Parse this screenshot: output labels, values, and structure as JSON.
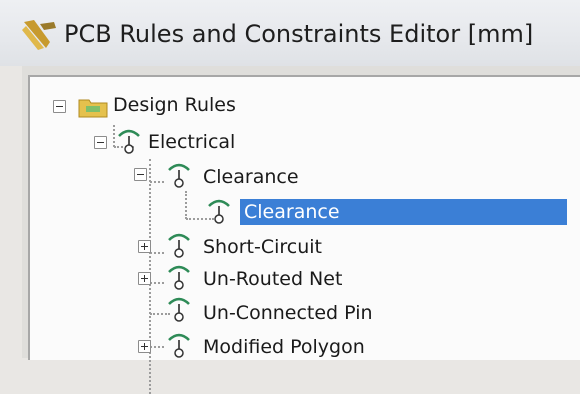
{
  "window": {
    "title": "PCB Rules and Constraints Editor [mm]",
    "app_icon": "pcb-editor-icon"
  },
  "tree": {
    "nodes": [
      {
        "label": "Design Rules",
        "icon": "folder-icon",
        "expander": "minus",
        "level": 0
      },
      {
        "label": "Electrical",
        "icon": "rule-icon",
        "expander": "minus",
        "level": 1
      },
      {
        "label": "Clearance",
        "icon": "rule-icon",
        "expander": "minus",
        "level": 2
      },
      {
        "label": "Clearance",
        "icon": "rule-icon",
        "expander": "none",
        "level": 3,
        "selected": true
      },
      {
        "label": "Short-Circuit",
        "icon": "rule-icon",
        "expander": "plus",
        "level": 2
      },
      {
        "label": "Un-Routed Net",
        "icon": "rule-icon",
        "expander": "plus",
        "level": 2
      },
      {
        "label": "Un-Connected Pin",
        "icon": "rule-icon",
        "expander": "none",
        "level": 2
      },
      {
        "label": "Modified Polygon",
        "icon": "rule-icon",
        "expander": "plus",
        "level": 2
      }
    ]
  },
  "colors": {
    "selection": "#3b7fd6",
    "rule_icon": "#2e8b57",
    "folder": "#e5c14d"
  }
}
